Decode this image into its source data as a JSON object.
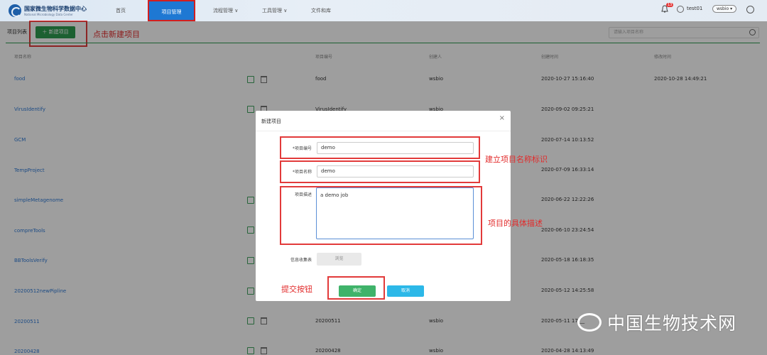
{
  "header": {
    "logo_cn": "国家微生物科学数据中心",
    "logo_en": "National Microbiology Data Center",
    "nav": [
      {
        "label": "首页"
      },
      {
        "label": "项目管理"
      },
      {
        "label": "流程管理 ∨"
      },
      {
        "label": "工具管理 ∨"
      },
      {
        "label": "文件和库"
      }
    ],
    "badge": "13",
    "user": "test01",
    "namespace": "wsbio ▾"
  },
  "toolbar": {
    "list_title": "项目列表",
    "new_button": "＋ 新建项目",
    "search_placeholder": "请输入项目名称"
  },
  "table": {
    "headers": [
      "项目名称",
      "项目编号",
      "创建人",
      "创建时间",
      "修改时间"
    ],
    "rows": [
      {
        "name": "food",
        "code": "food",
        "creator": "wsbio",
        "created": "2020-10-27 15:16:40",
        "modified": "2020-10-28 14:49:21"
      },
      {
        "name": "VirusIdentify",
        "code": "VirusIdentify",
        "creator": "wsbio",
        "created": "2020-09-02 09:25:21",
        "modified": ""
      },
      {
        "name": "GCM",
        "code": "",
        "creator": "",
        "created": "2020-07-14 10:13:52",
        "modified": ""
      },
      {
        "name": "TempProject",
        "code": "",
        "creator": "",
        "created": "2020-07-09 16:33:14",
        "modified": ""
      },
      {
        "name": "simpleMetagenome",
        "code": "",
        "creator": "",
        "created": "2020-06-22 12:22:26",
        "modified": ""
      },
      {
        "name": "compreTools",
        "code": "",
        "creator": "",
        "created": "2020-06-10 23:24:54",
        "modified": ""
      },
      {
        "name": "BBToolsVerify",
        "code": "",
        "creator": "",
        "created": "2020-05-18 16:18:35",
        "modified": ""
      },
      {
        "name": "20200512newPipline",
        "code": "",
        "creator": "",
        "created": "2020-05-12 14:25:58",
        "modified": ""
      },
      {
        "name": "20200511",
        "code": "20200511",
        "creator": "wsbio",
        "created": "2020-05-11 17:__",
        "modified": ""
      },
      {
        "name": "20200428",
        "code": "20200428",
        "creator": "wsbio",
        "created": "2020-04-28 14:13:49",
        "modified": ""
      }
    ]
  },
  "modal": {
    "title": "新建项目",
    "close": "×",
    "code_label": "*项目编号",
    "code_value": "demo",
    "name_label": "*项目名称",
    "name_value": "demo",
    "desc_label": "项目描述",
    "desc_value": "a demo job",
    "info_label": "信息收集表",
    "browse": "浏览",
    "ok": "确定",
    "cancel": "取消"
  },
  "annotations": {
    "click_new": "点击新建项目",
    "create_name": "建立项目名称标识",
    "describe": "项目的具体描述",
    "submit": "提交按钮"
  },
  "watermark": "中国生物技术网"
}
